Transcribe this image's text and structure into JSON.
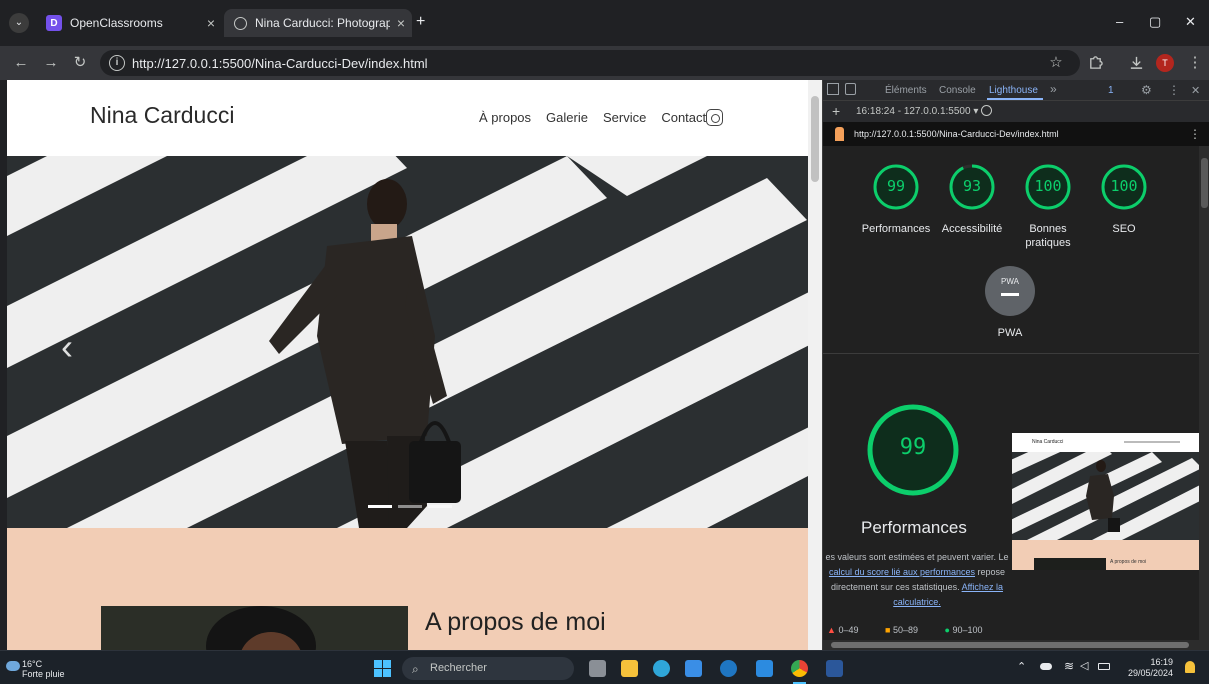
{
  "browser": {
    "tabs": [
      {
        "title": "OpenClassrooms",
        "close": "×"
      },
      {
        "title": "Nina Carducci: Photographe à B",
        "close": "×"
      }
    ],
    "new_tab": "+",
    "url": "http://127.0.0.1:5500/Nina-Carducci-Dev/index.html",
    "profile_initial": "T",
    "window_controls": {
      "minimize": "–",
      "restore": "▢",
      "close": "✕"
    }
  },
  "site": {
    "brand": "Nina Carducci",
    "nav": [
      "À propos",
      "Galerie",
      "Service",
      "Contact"
    ],
    "carousel_prev": "‹",
    "about_heading": "A propos de moi"
  },
  "devtools": {
    "tabs": [
      "Éléments",
      "Console",
      "Lighthouse"
    ],
    "more_tabs": "»",
    "issues_count": "1",
    "session": "16:18:24 - 127.0.0.1:5500 ▾",
    "report_url": "http://127.0.0.1:5500/Nina-Carducci-Dev/index.html",
    "scores": [
      {
        "value": 99,
        "label": "Performances"
      },
      {
        "value": 93,
        "label": "Accessibilité"
      },
      {
        "value": 100,
        "label": "Bonnes pratiques"
      },
      {
        "value": 100,
        "label": "SEO"
      }
    ],
    "pwa": {
      "badge": "PWA",
      "label": "PWA"
    },
    "performance": {
      "score": 99,
      "title": "Performances",
      "desc_1": "es valeurs sont estimées et peuvent varier. Le",
      "desc_link_1": "calcul du score lié aux performances",
      "desc_2": " repose directement sur ces statistiques. ",
      "desc_link_2": "Affichez la calculatrice.",
      "thumbnail": {
        "brand": "Nina Carducci",
        "about": "A propos de moi"
      }
    },
    "legend": [
      {
        "range": "0–49",
        "color": "#ff4e42"
      },
      {
        "range": "50–89",
        "color": "#ffa400"
      },
      {
        "range": "90–100",
        "color": "#0cce6b"
      }
    ]
  },
  "taskbar": {
    "temp": "16°C",
    "condition": "Forte pluie",
    "search_placeholder": "Rechercher",
    "time": "16:19",
    "date": "29/05/2024"
  }
}
